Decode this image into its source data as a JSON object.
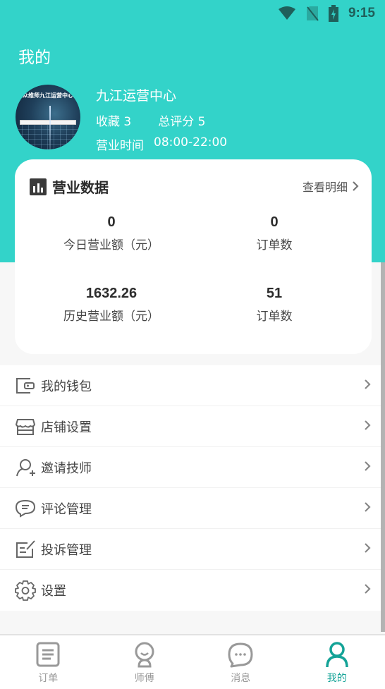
{
  "status_bar": {
    "time": "9:15",
    "icons": [
      "wifi-icon",
      "no-sim-icon",
      "battery-charging-icon"
    ]
  },
  "header": {
    "title": "我的",
    "accent_color": "#33d3c9"
  },
  "profile": {
    "avatar_text": "众维师九江运营中心",
    "store_name": "九江运营中心",
    "favorites_label": "收藏 3",
    "rating_label": "总评分 5",
    "hours_label": "营业时间",
    "hours_value": "08:00-22:00"
  },
  "business_card": {
    "title": "营业数据",
    "detail_link": "查看明细",
    "stats": [
      {
        "value": "0",
        "label": "今日营业额（元）"
      },
      {
        "value": "0",
        "label": "订单数"
      },
      {
        "value": "1632.26",
        "label": "历史营业额（元）"
      },
      {
        "value": "51",
        "label": "订单数"
      }
    ]
  },
  "menu": {
    "items": [
      {
        "label": "我的钱包",
        "icon": "wallet-icon"
      },
      {
        "label": "店铺设置",
        "icon": "store-icon"
      },
      {
        "label": "邀请技师",
        "icon": "invite-user-icon"
      },
      {
        "label": "评论管理",
        "icon": "comment-icon"
      },
      {
        "label": "投诉管理",
        "icon": "complaint-icon"
      },
      {
        "label": "设置",
        "icon": "gear-icon"
      }
    ]
  },
  "tabbar": {
    "active_color": "#14a397",
    "tabs": [
      {
        "label": "订单",
        "icon": "order-list-icon",
        "active": false
      },
      {
        "label": "师傅",
        "icon": "master-icon",
        "active": false
      },
      {
        "label": "消息",
        "icon": "message-icon",
        "active": false
      },
      {
        "label": "我的",
        "icon": "profile-icon",
        "active": true
      }
    ]
  }
}
